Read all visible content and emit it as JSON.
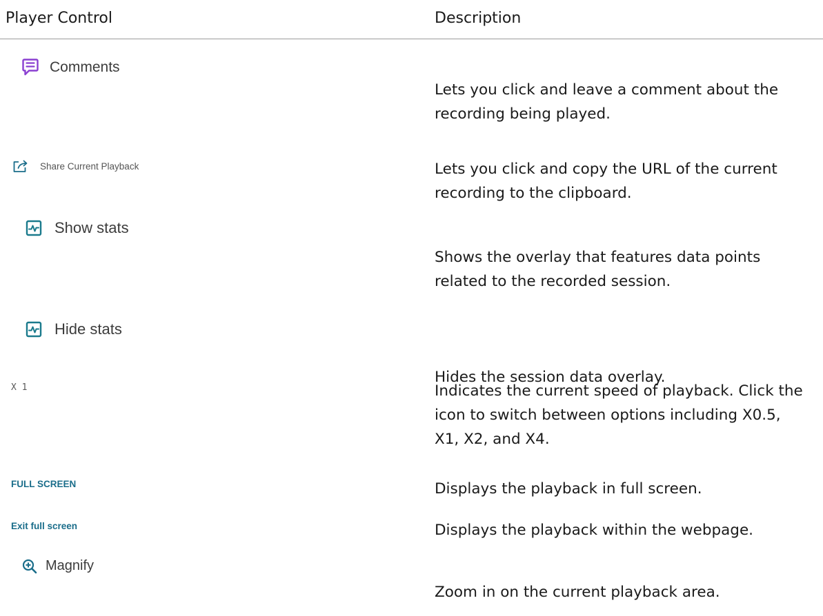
{
  "header": {
    "col1": "Player Control",
    "col2": "Description"
  },
  "rows": [
    {
      "control": "Comments",
      "icon": "comment-icon",
      "description": "Lets you click and leave a comment about the recording being played."
    },
    {
      "control": "Share Current Playback",
      "icon": "share-icon",
      "description": "Lets you click and copy the URL of the current recording to the clipboard."
    },
    {
      "control": "Show stats",
      "icon": "stats-icon",
      "description": "Shows the overlay that features data points related to the recorded session."
    },
    {
      "control": "Hide stats",
      "icon": "stats-icon",
      "description": "Hides the session data overlay."
    },
    {
      "control": "X 1",
      "description": "Indicates the current speed of playback. Click the icon to switch between options including X0.5, X1, X2, and X4."
    },
    {
      "control": "FULL SCREEN",
      "description": "Displays the playback in full screen."
    },
    {
      "control": "Exit full screen",
      "description": "Displays the playback within the webpage."
    },
    {
      "control": "Magnify",
      "icon": "zoom-in-icon",
      "description": "Zoom in on the current playback area."
    }
  ],
  "colors": {
    "comment_icon": "#8a3fd1",
    "stats_icon": "#1a7a8c",
    "share_icon": "#1a6d8a",
    "link_text": "#1a6d8a",
    "magnify_icon": "#1a6d8a"
  }
}
